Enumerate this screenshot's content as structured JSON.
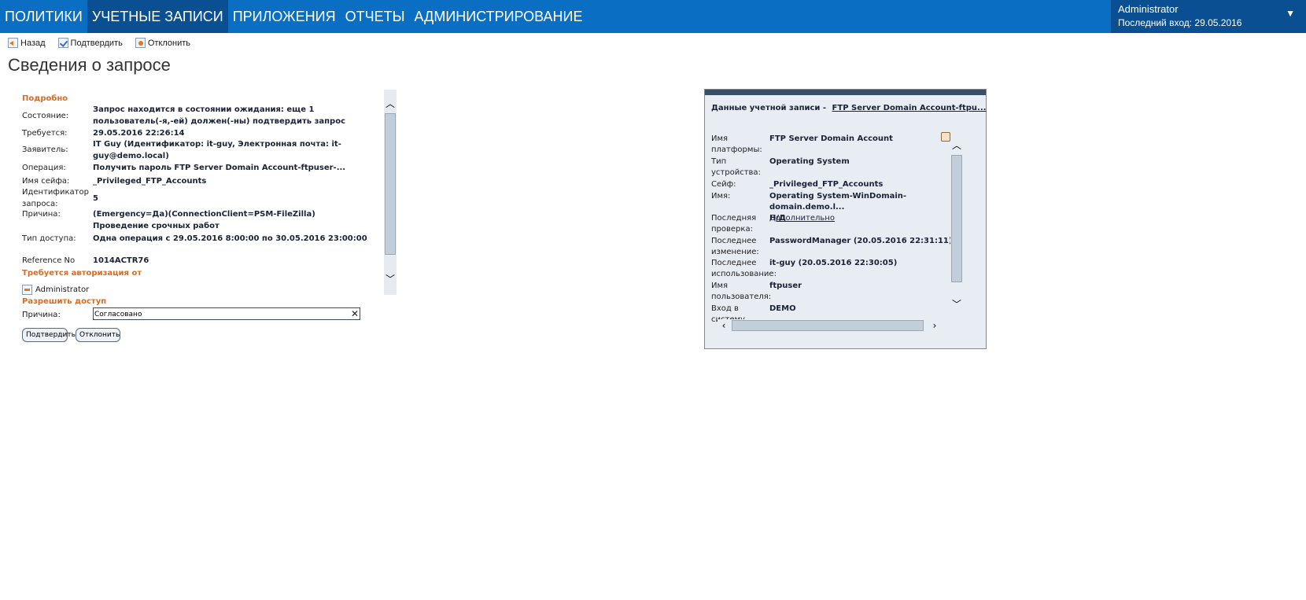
{
  "nav": {
    "items": [
      {
        "label": "ПОЛИТИКИ"
      },
      {
        "label": "УЧЕТНЫЕ ЗАПИСИ"
      },
      {
        "label": "ПРИЛОЖЕНИЯ"
      },
      {
        "label": "ОТЧЕТЫ"
      },
      {
        "label": "АДМИНИСТРИРОВАНИЕ"
      }
    ],
    "active": "УЧЕТНЫЕ ЗАПИСИ"
  },
  "user": {
    "name": "Administrator",
    "last_login": "Последний вход: 29.05.2016"
  },
  "toolbar": {
    "back": "Назад",
    "confirm": "Подтвердить",
    "reject": "Отклонить"
  },
  "page_title": "Сведения о запросе",
  "details": {
    "section_title": "Подробно",
    "rows": [
      {
        "label": "Состояние:",
        "value": "Запрос находится в состоянии ожидания: еще 1 пользователь(-я,-ей) должен(-ны) подтвердить запрос"
      },
      {
        "label": "Требуется:",
        "value": "29.05.2016 22:26:14"
      },
      {
        "label": "Заявитель:",
        "value": "IT Guy (Идентификатор: it-guy, Электронная почта: it-guy@demo.local)"
      },
      {
        "label": "Операция:",
        "value": "Получить пароль FTP Server Domain Account-ftpuser-..."
      },
      {
        "label": "Имя сейфа:",
        "value": "_Privileged_FTP_Accounts"
      },
      {
        "label": "Идентификатор запроса:",
        "value": "5"
      },
      {
        "label": "Причина:",
        "value": "(Emergency=Да)(ConnectionClient=PSM-FileZilla) Проведение срочных работ"
      },
      {
        "label": "Тип доступа:",
        "value": "Одна операция с 29.05.2016 8:00:00 по 30.05.2016 23:00:00"
      },
      {
        "label": "Reference No",
        "value": "1014ACTR76"
      }
    ]
  },
  "authorization": {
    "title": "Требуется авторизация от",
    "approver": "Administrator"
  },
  "grant": {
    "title": "Разрешить доступ",
    "reason_label": "Причина:",
    "reason_value": "Согласовано",
    "confirm_button": "Подтвердить",
    "reject_button": "Отклонить"
  },
  "account": {
    "header_label": "Данные учетной записи -",
    "header_link": "FTP Server Domain Account-ftpu...",
    "rows": [
      {
        "label": "Имя платформы:",
        "value": "FTP Server Domain Account"
      },
      {
        "label": "Тип устройства:",
        "value": "Operating System"
      },
      {
        "label": "Сейф:",
        "value": "_Privileged_FTP_Accounts"
      },
      {
        "label": "Имя:",
        "value": "Operating System-WinDomain-domain.demo.l...",
        "link": "Дополнительно"
      },
      {
        "label": "Последняя проверка:",
        "value": "Н/Д"
      },
      {
        "label": "Последнее изменение:",
        "value": "PasswordManager (20.05.2016 22:31:11)"
      },
      {
        "label": "Последнее использование:",
        "value": "it-guy (20.05.2016 22:30:05)"
      },
      {
        "label": "Имя пользователя:",
        "value": "ftpuser"
      },
      {
        "label": "Вход в систему",
        "value": "DEMO"
      }
    ]
  }
}
